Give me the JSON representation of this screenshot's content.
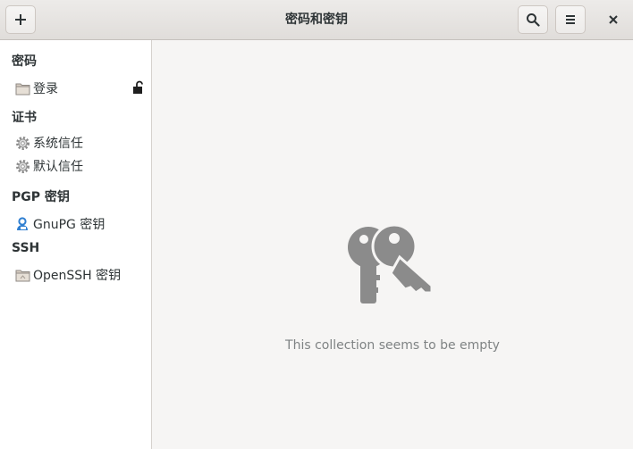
{
  "window": {
    "title": "密码和密钥"
  },
  "header": {
    "add_icon": "plus-icon",
    "search_icon": "search-icon",
    "menu_icon": "hamburger-menu-icon",
    "close_icon": "close-icon"
  },
  "sidebar": {
    "sections": [
      {
        "title": "密码",
        "items": [
          {
            "label": "登录",
            "icon": "folder-icon",
            "badge_icon": "lock-icon"
          }
        ]
      },
      {
        "title": "证书",
        "items": [
          {
            "label": "系统信任",
            "icon": "gear-icon"
          },
          {
            "label": "默认信任",
            "icon": "gear-icon"
          }
        ]
      },
      {
        "title": "PGP 密钥",
        "items": [
          {
            "label": "GnuPG 密钥",
            "icon": "user-key-icon"
          }
        ]
      },
      {
        "title": "SSH",
        "items": [
          {
            "label": "OpenSSH 密钥",
            "icon": "folder-icon"
          }
        ]
      }
    ]
  },
  "main": {
    "empty_icon": "keys-icon",
    "empty_message": "This collection seems to be empty"
  },
  "colors": {
    "header_bg": "#e0ddda",
    "sidebar_bg": "#ffffff",
    "content_bg": "#f6f5f4",
    "icon_gray": "#8b8b8b",
    "muted_text": "#7f8384"
  }
}
